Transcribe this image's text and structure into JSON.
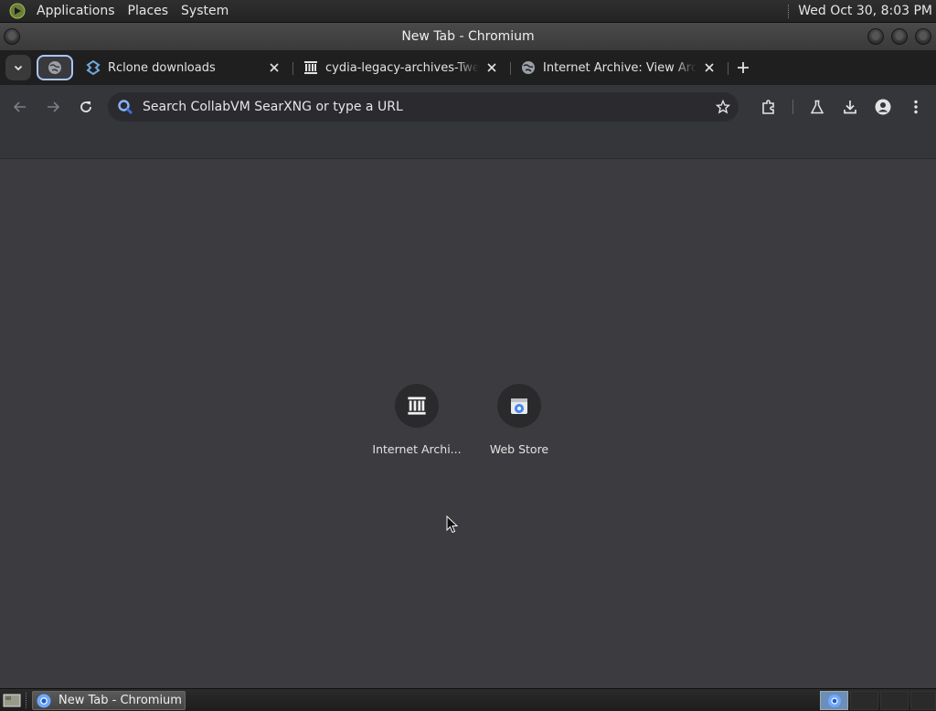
{
  "top_panel": {
    "menus": [
      "Applications",
      "Places",
      "System"
    ],
    "clock": "Wed Oct 30,  8:03 PM"
  },
  "window": {
    "title": "New Tab - Chromium"
  },
  "tabs": [
    {
      "title": "Rclone downloads",
      "icon": "rclone-icon"
    },
    {
      "title": "cydia-legacy-archives-Tweaks",
      "icon": "archive-icon"
    },
    {
      "title": "Internet Archive: View Archive",
      "icon": "globe-icon"
    }
  ],
  "toolbar": {
    "omnibox_placeholder": "Search CollabVM SearXNG or type a URL"
  },
  "shortcuts": [
    {
      "label": "Internet Archi...",
      "icon": "archive-icon"
    },
    {
      "label": "Web Store",
      "icon": "web-store-icon"
    }
  ],
  "taskbar": {
    "task_label": "New Tab - Chromium"
  },
  "colors": {
    "accent": "#a8c7fa",
    "content_bg": "#3c3c40",
    "toolbar_bg": "#35363a",
    "tabstrip_bg": "#1f1f1f"
  }
}
